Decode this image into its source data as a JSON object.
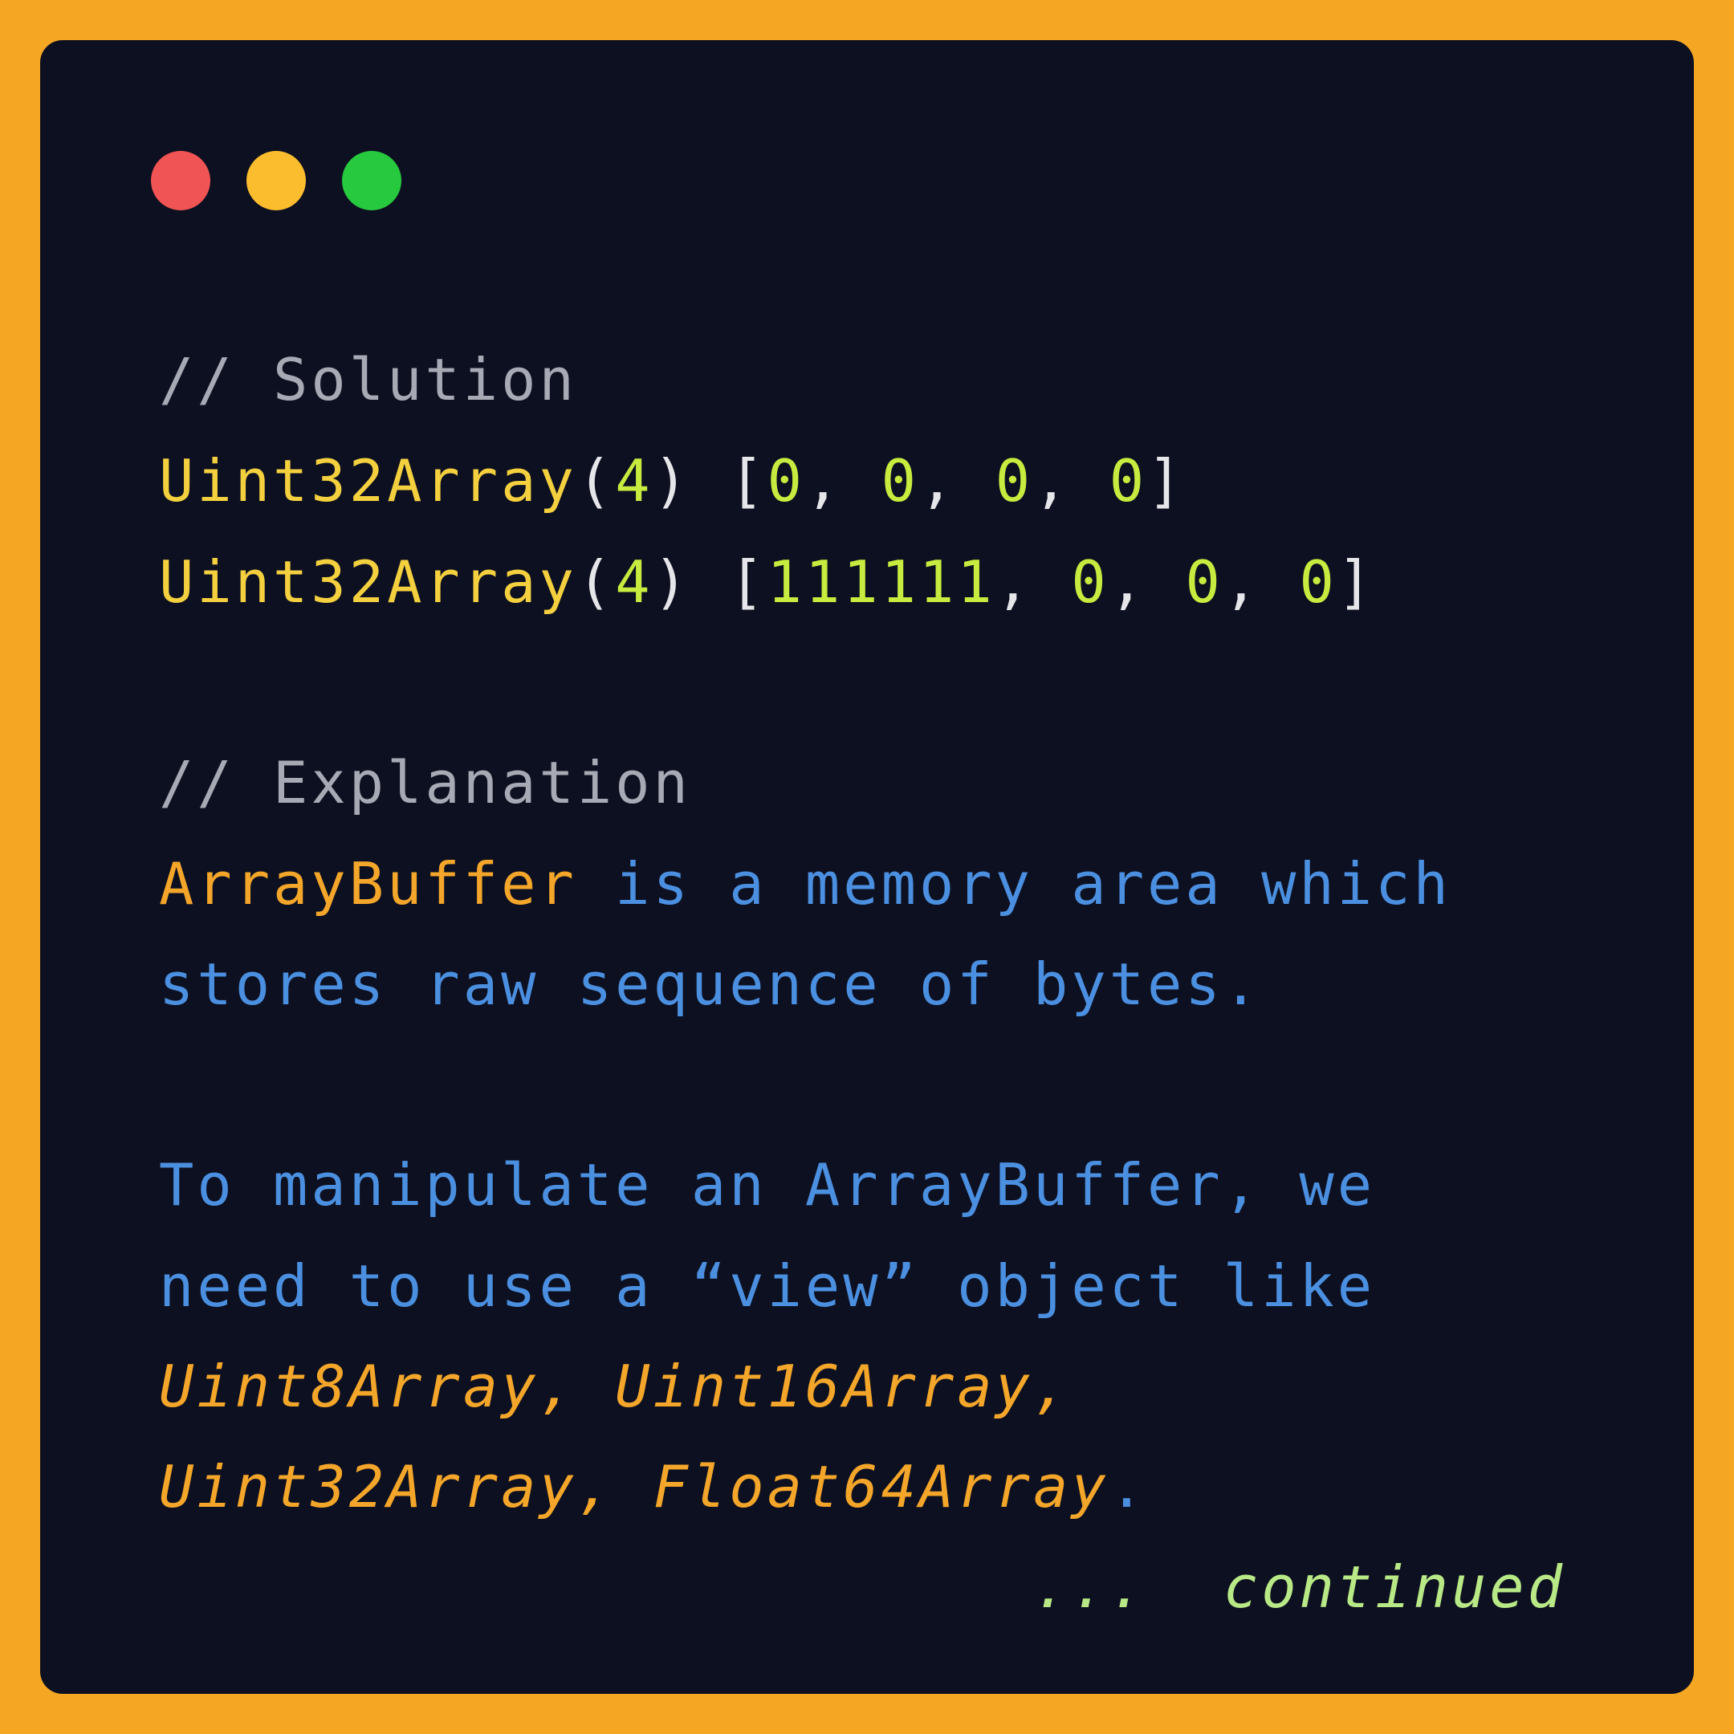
{
  "colors": {
    "background": "#f5a623",
    "window": "#0d1020",
    "dot_red": "#f05454",
    "dot_yellow": "#fbbd2e",
    "dot_green": "#27c93f"
  },
  "window_controls": [
    "close",
    "minimize",
    "zoom"
  ],
  "code": {
    "comment_solution": "// Solution",
    "line1": {
      "fn": "Uint32Array",
      "open": "(",
      "arg": "4",
      "close_bracket": ") [",
      "v1": "0",
      "sep1": ", ",
      "v2": "0",
      "sep2": ", ",
      "v3": "0",
      "sep3": ", ",
      "v4": "0",
      "end": "]"
    },
    "line2": {
      "fn": "Uint32Array",
      "open": "(",
      "arg": "4",
      "close_bracket": ") [",
      "v1": "111111",
      "sep1": ", ",
      "v2": "0",
      "sep2": ", ",
      "v3": "0",
      "sep3": ", ",
      "v4": "0",
      "end": "]"
    },
    "comment_explanation": "// Explanation",
    "explain1_kw": "ArrayBuffer",
    "explain1_rest": " is a memory area which",
    "explain2": "stores raw sequence of bytes.",
    "explain3": "To manipulate an ArrayBuffer, we",
    "explain4": "need to use a “view” object like",
    "types1": "Uint8Array, Uint16Array,",
    "types2": "Uint32Array, Float64Array",
    "types2_end": ".",
    "continued": "...  continued"
  }
}
